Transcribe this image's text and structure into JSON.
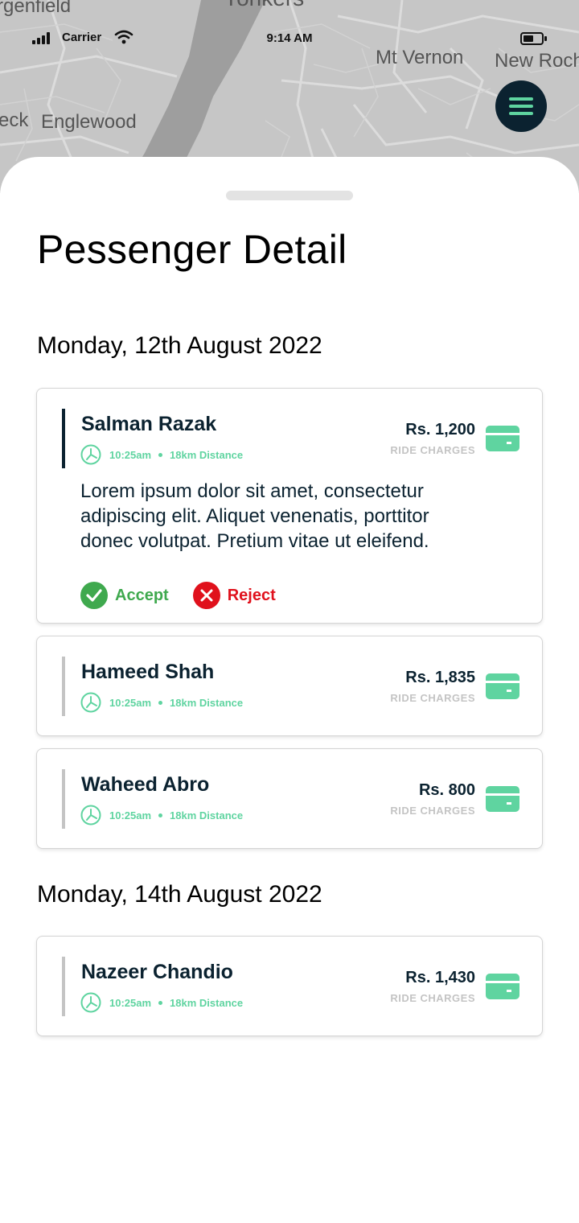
{
  "map": {
    "labels": [
      "rgenfield",
      "Yonkers",
      "Mt Vernon",
      "New Roch",
      "eck",
      "Englewood"
    ]
  },
  "status_bar": {
    "carrier": "Carrier",
    "time": "9:14 AM",
    "icons": [
      "signal-icon",
      "wifi-icon",
      "battery-icon"
    ]
  },
  "menu_icon": "hamburger-menu-icon",
  "page": {
    "title": "Pessenger Detail"
  },
  "groups": [
    {
      "date": "Monday, 12th August 2022",
      "rides": [
        {
          "name": "Salman Razak",
          "time": "10:25am",
          "distance": "18km Distance",
          "price": "Rs. 1,200",
          "price_label": "RIDE CHARGES",
          "description": "Lorem ipsum dolor sit amet, consectetur adipiscing elit. Aliquet venenatis, porttitor donec volutpat. Pretium vitae ut eleifend.",
          "accept_label": "Accept",
          "reject_label": "Reject"
        },
        {
          "name": "Hameed Shah",
          "time": "10:25am",
          "distance": "18km Distance",
          "price": "Rs. 1,835",
          "price_label": "RIDE CHARGES"
        },
        {
          "name": "Waheed Abro",
          "time": "10:25am",
          "distance": "18km Distance",
          "price": "Rs. 800",
          "price_label": "RIDE CHARGES"
        }
      ]
    },
    {
      "date": "Monday, 14th August 2022",
      "rides": [
        {
          "name": "Nazeer Chandio",
          "time": "10:25am",
          "distance": "18km Distance",
          "price": "Rs. 1,430",
          "price_label": "RIDE CHARGES"
        }
      ]
    }
  ],
  "colors": {
    "navy": "#0b2230",
    "mint": "#5fd4a0",
    "accept": "#3fa94e",
    "reject": "#e0111c",
    "muted": "#c4c4c4"
  }
}
